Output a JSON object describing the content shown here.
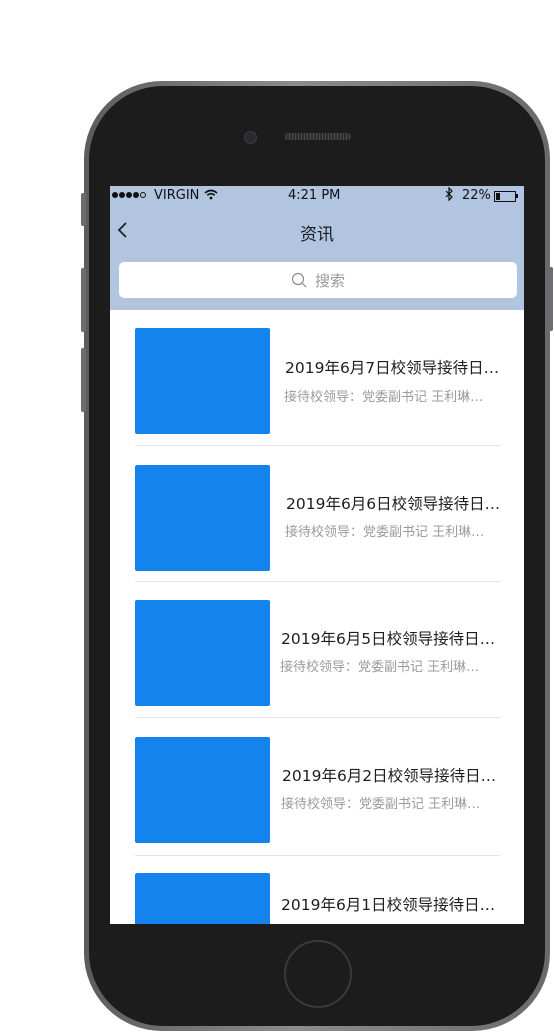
{
  "status_bar": {
    "carrier": "VIRGIN",
    "time": "4:21 PM",
    "battery": "22%",
    "battery_level": 0.22
  },
  "nav": {
    "title": "资讯"
  },
  "search": {
    "placeholder": "搜索"
  },
  "news": [
    {
      "title": "2019年6月7日校领导接待日…",
      "subtitle": "接待校领导：党委副书记 王利琳…"
    },
    {
      "title": "2019年6月6日校领导接待日…",
      "subtitle": "接待校领导：党委副书记 王利琳…"
    },
    {
      "title": "2019年6月5日校领导接待日…",
      "subtitle": "接待校领导：党委副书记 王利琳…"
    },
    {
      "title": "2019年6月2日校领导接待日…",
      "subtitle": "接待校领导：党委副书记 王利琳…"
    },
    {
      "title": "2019年6月1日校领导接待日…",
      "subtitle": ""
    }
  ],
  "colors": {
    "nav_bg": "#b1c4e0",
    "thumbnail": "#1583ed"
  }
}
